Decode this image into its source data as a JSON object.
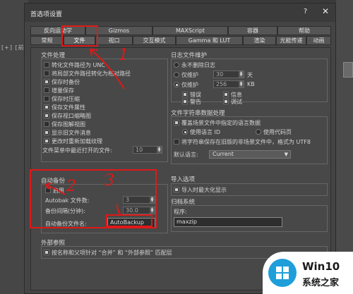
{
  "left_strip": {
    "mark": "[+] [前]"
  },
  "dialog": {
    "title": "首选项设置",
    "help": "?",
    "close": "✕"
  },
  "tabs_row1": [
    "反向运动学",
    "Gizmos",
    "MAXScript",
    "容器",
    "帮助"
  ],
  "tabs_row2": [
    "常规",
    "文件",
    "视口",
    "交互模式",
    "Gamma 和 LUT",
    "渲染",
    "光能传递",
    "动画"
  ],
  "active_tab": "文件",
  "file_handling": {
    "title": "文件处理",
    "items": [
      {
        "label": "转化文件路径为 UNC",
        "checked": false
      },
      {
        "label": "将局部文件路径转化为相对路径",
        "checked": false
      },
      {
        "label": "保存时备份",
        "checked": true
      },
      {
        "label": "增量保存",
        "checked": false
      },
      {
        "label": "保存时压缩",
        "checked": false
      },
      {
        "label": "保存文件属性",
        "checked": true
      },
      {
        "label": "保存视口缩略图",
        "checked": true
      },
      {
        "label": "保存图解视图",
        "checked": false
      },
      {
        "label": "显示旧文件消息",
        "checked": true
      },
      {
        "label": "更改时重新加载纹理",
        "checked": true
      }
    ],
    "recent_label": "文件菜单中最近打开的文件:",
    "recent_value": "10"
  },
  "autobackup": {
    "title": "自动备份",
    "enable_label": "启用",
    "enable_checked": false,
    "count_label": "Autobak 文件数:",
    "count_value": "3",
    "interval_label": "备份间隔(分钟):",
    "interval_value": "30.0",
    "name_label": "自动备份文件名:",
    "name_value": "AutoBackup"
  },
  "log": {
    "title": "日志文件维护",
    "never_delete": "永不删除日志",
    "keep_days_label": "仅维护",
    "keep_days_value": "30",
    "days_unit": "天",
    "keep_kb_label": "仅维护",
    "keep_kb_value": "256",
    "kb_unit": "KB",
    "selected_option": 3,
    "error": "错误",
    "info": "信息",
    "warning": "警告",
    "debug": "调试"
  },
  "charset": {
    "title": "文件字符串数据处理",
    "override": "覆盖场景文件中指定的语言数据",
    "use_lang_id": "使用语言 ID",
    "use_codepage": "使用代码页",
    "save_utf8": "将字符串保存在旧版的非场景文件中，格式为 UTF8",
    "default_lang_label": "默认语言:",
    "default_lang_value": "Current"
  },
  "import": {
    "title": "导入选项",
    "zoom_label": "导入时最大化显示"
  },
  "archive": {
    "title": "归档系统",
    "program_label": "程序:",
    "program_value": "maxzip"
  },
  "xref": {
    "title": "外部参照",
    "label": "按名称和父项针对 “合并” 和 “外部参照” 匹配层"
  },
  "annotations": {
    "n1": "1",
    "n2": "2",
    "n3": "3",
    "color": "#e01818"
  },
  "watermark": {
    "t1": "Win10",
    "t2": "系统之家",
    "logo_color": "#1e9fd9"
  }
}
